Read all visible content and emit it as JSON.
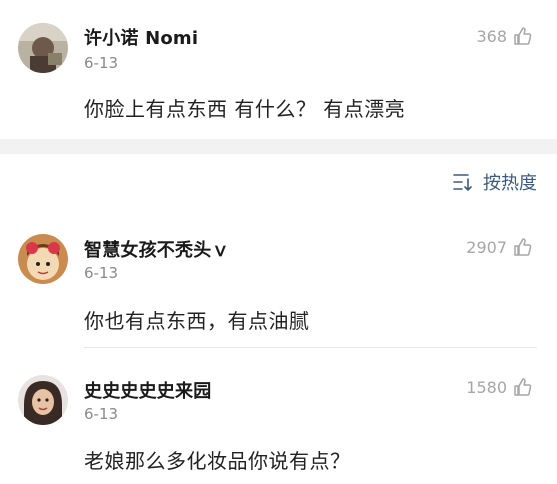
{
  "top_comment": {
    "username": "许小诺 Nomi",
    "date": "6-13",
    "text": "你脸上有点东西 有什么？ 有点漂亮",
    "likes": "368"
  },
  "sort": {
    "label": "按热度"
  },
  "comments": [
    {
      "username": "智慧女孩不秃头ｖ",
      "date": "6-13",
      "text": "你也有点东西，有点油腻",
      "likes": "2907"
    },
    {
      "username": "史史史史史来园",
      "date": "6-13",
      "text": "老娘那么多化妆品你说有点？",
      "likes": "1580"
    }
  ],
  "icons": {
    "like": "thumbs-up-icon",
    "sort": "sort-lines-icon"
  },
  "colors": {
    "accent": "#3c5a7e",
    "muted": "#a6a6a6",
    "band": "#f2f2f2"
  }
}
